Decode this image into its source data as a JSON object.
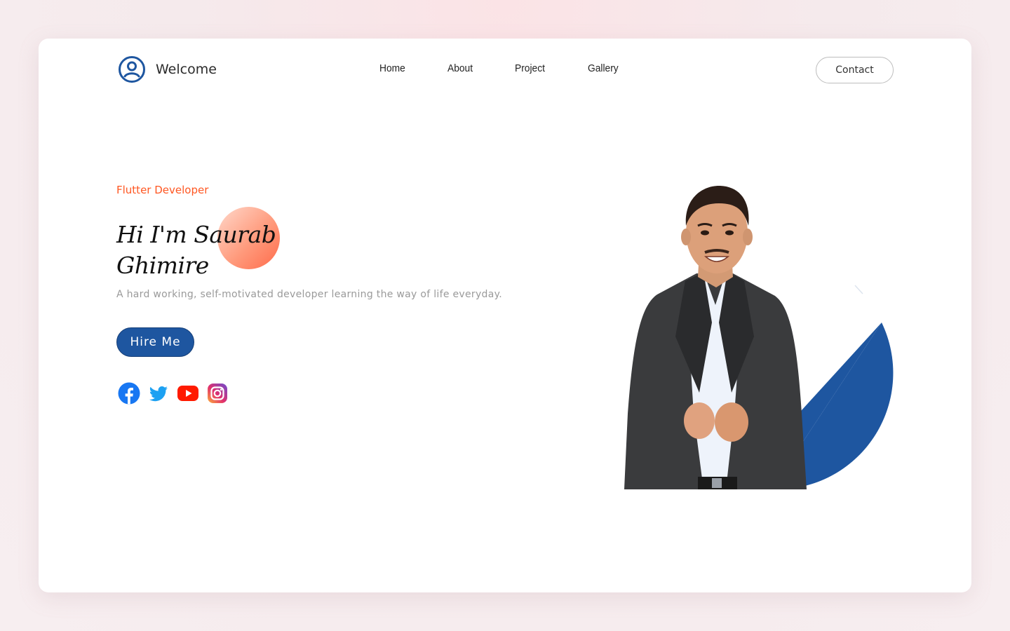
{
  "header": {
    "brand_title": "Welcome",
    "nav": [
      "Home",
      "About",
      "Project",
      "Gallery"
    ],
    "contact_label": "Contact"
  },
  "hero": {
    "tagline": "Flutter Developer",
    "name_line1": "Hi I'm Saurab",
    "name_line2": "Ghimire",
    "description": "A hard working, self-motivated developer learning the way of life everyday.",
    "hire_label": "Hire Me"
  },
  "socials": [
    "facebook-icon",
    "twitter-icon",
    "youtube-icon",
    "instagram-icon"
  ],
  "colors": {
    "accent_orange": "#ff5722",
    "primary_blue": "#1e56a0",
    "text_dark": "#222222",
    "text_muted": "#9a9a9a"
  }
}
